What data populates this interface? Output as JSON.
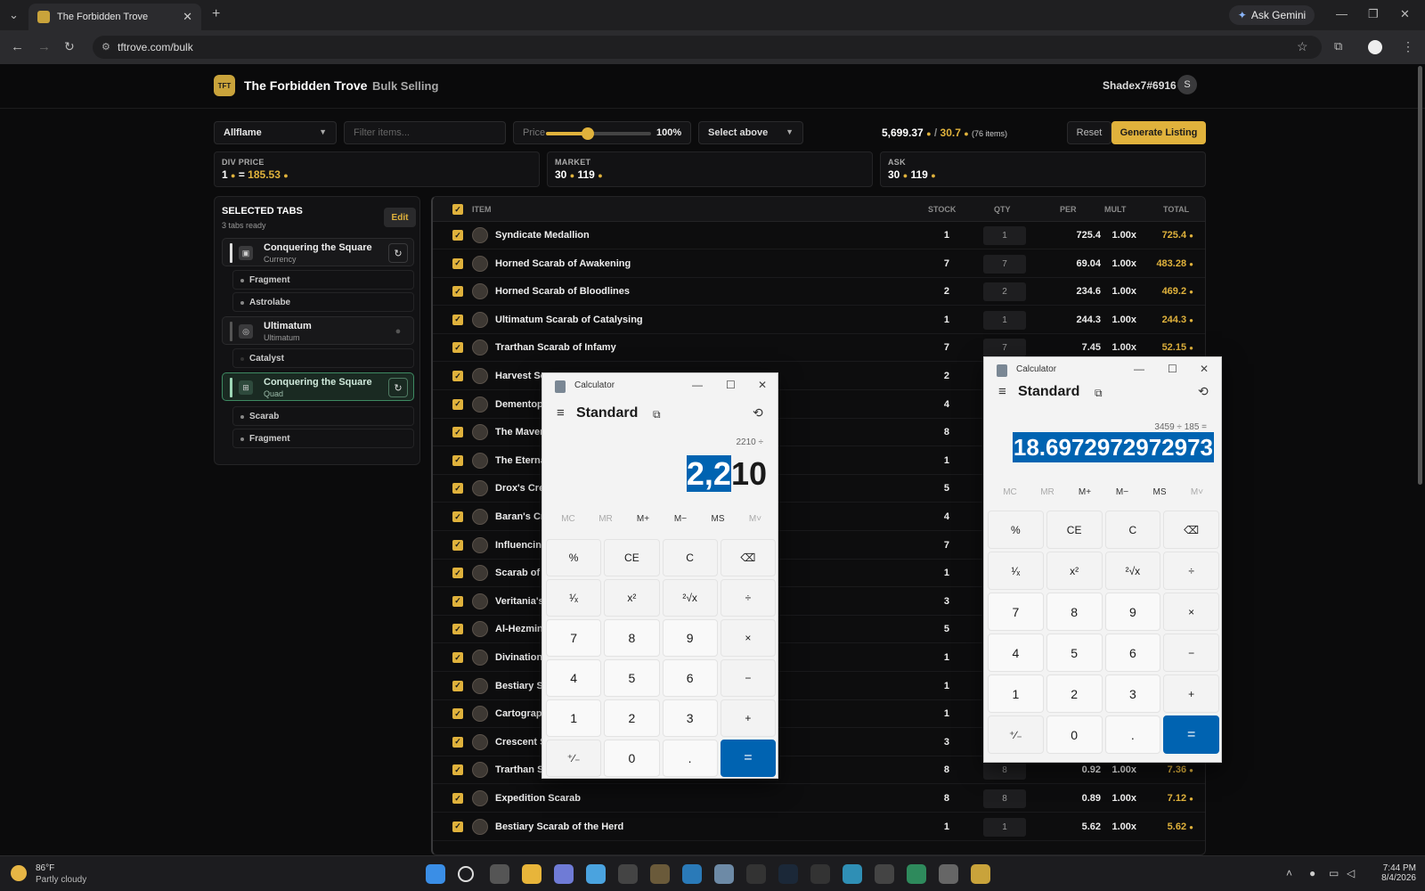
{
  "browser": {
    "tab_title": "The Forbidden Trove",
    "url": "tftrove.com/bulk",
    "ask_gemini": "Ask Gemini"
  },
  "header": {
    "logo_text": "TFT",
    "brand": "The Forbidden Trove",
    "nav_bulk": "Bulk Selling",
    "username": "Shadex7#6916",
    "avatar_letter": "S"
  },
  "controls": {
    "league": "Allflame",
    "filter_placeholder": "Filter items...",
    "price_label": "Price",
    "price_percent": "100%",
    "price_fraction": 0.4,
    "select_above": "Select above",
    "total_chaos": "5,699.37",
    "total_sep": "/",
    "total_div": "30.7",
    "total_items": "(76 items)",
    "reset": "Reset",
    "generate": "Generate Listing"
  },
  "cards": {
    "div_price": {
      "label": "DIV PRICE",
      "prefix": "1",
      "eq": "=",
      "value": "185.53"
    },
    "market": {
      "label": "MARKET",
      "div": "30",
      "chaos": "119"
    },
    "ask": {
      "label": "ASK",
      "div": "30",
      "chaos": "119"
    }
  },
  "sidebar": {
    "title": "SELECTED TABS",
    "subtitle": "3 tabs ready",
    "edit": "Edit",
    "groups": [
      {
        "name": "Conquering the Square",
        "type": "Currency",
        "subtabs": [
          "Fragment",
          "Astrolabe"
        ]
      },
      {
        "name": "Ultimatum",
        "type": "Ultimatum",
        "subtabs": [
          "Catalyst"
        ]
      },
      {
        "name": "Conquering the Square",
        "type": "Quad",
        "subtabs": [
          "Scarab",
          "Fragment"
        ]
      }
    ]
  },
  "table": {
    "headers": {
      "item": "ITEM",
      "stock": "STOCK",
      "qty": "QTY",
      "per": "PER",
      "mult": "MULT",
      "total": "TOTAL"
    },
    "rows": [
      {
        "name": "Syndicate Medallion",
        "stock": "1",
        "qty": "1",
        "per": "725.4",
        "mult": "1.00x",
        "total": "725.4"
      },
      {
        "name": "Horned Scarab of Awakening",
        "stock": "7",
        "qty": "7",
        "per": "69.04",
        "mult": "1.00x",
        "total": "483.28"
      },
      {
        "name": "Horned Scarab of Bloodlines",
        "stock": "2",
        "qty": "2",
        "per": "234.6",
        "mult": "1.00x",
        "total": "469.2"
      },
      {
        "name": "Ultimatum Scarab of Catalysing",
        "stock": "1",
        "qty": "1",
        "per": "244.3",
        "mult": "1.00x",
        "total": "244.3"
      },
      {
        "name": "Trarthan Scarab of Infamy",
        "stock": "7",
        "qty": "7",
        "per": "7.45",
        "mult": "1.00x",
        "total": "52.15"
      },
      {
        "name": "Harvest Sc",
        "stock": "2",
        "qty": "",
        "per": "",
        "mult": "",
        "total": ""
      },
      {
        "name": "Dementop",
        "stock": "4",
        "qty": "",
        "per": "",
        "mult": "",
        "total": ""
      },
      {
        "name": "The Maven",
        "stock": "8",
        "qty": "",
        "per": "",
        "mult": "",
        "total": ""
      },
      {
        "name": "The Eterna",
        "stock": "1",
        "qty": "",
        "per": "",
        "mult": "",
        "total": ""
      },
      {
        "name": "Drox's Cre",
        "stock": "5",
        "qty": "",
        "per": "",
        "mult": "",
        "total": ""
      },
      {
        "name": "Baran's Cr",
        "stock": "4",
        "qty": "",
        "per": "",
        "mult": "",
        "total": ""
      },
      {
        "name": "Influencing",
        "stock": "7",
        "qty": "",
        "per": "",
        "mult": "",
        "total": ""
      },
      {
        "name": "Scarab of",
        "stock": "1",
        "qty": "",
        "per": "",
        "mult": "",
        "total": ""
      },
      {
        "name": "Veritania's",
        "stock": "3",
        "qty": "",
        "per": "",
        "mult": "",
        "total": ""
      },
      {
        "name": "Al-Hezmin",
        "stock": "5",
        "qty": "",
        "per": "",
        "mult": "",
        "total": ""
      },
      {
        "name": "Divination",
        "stock": "1",
        "qty": "",
        "per": "",
        "mult": "",
        "total": ""
      },
      {
        "name": "Bestiary S",
        "stock": "1",
        "qty": "",
        "per": "",
        "mult": "",
        "total": ""
      },
      {
        "name": "Cartograpl",
        "stock": "1",
        "qty": "",
        "per": "",
        "mult": "",
        "total": ""
      },
      {
        "name": "Crescent S",
        "stock": "3",
        "qty": "",
        "per": "",
        "mult": "",
        "total": ""
      },
      {
        "name": "Trarthan Scarab",
        "stock": "8",
        "qty": "8",
        "per": "0.92",
        "mult": "1.00x",
        "total": "7.36"
      },
      {
        "name": "Expedition Scarab",
        "stock": "8",
        "qty": "8",
        "per": "0.89",
        "mult": "1.00x",
        "total": "7.12"
      },
      {
        "name": "Bestiary Scarab of the Herd",
        "stock": "1",
        "qty": "1",
        "per": "5.62",
        "mult": "1.00x",
        "total": "5.62"
      }
    ]
  },
  "calc1": {
    "title": "Calculator",
    "mode": "Standard",
    "expression": "2210 ÷",
    "display_sel": "2,2",
    "display_rest": "10",
    "memory": [
      "MC",
      "MR",
      "M+",
      "M−",
      "MS",
      "M˅"
    ],
    "keys": [
      "%",
      "CE",
      "C",
      "⌫",
      "¹⁄ₓ",
      "x²",
      "²√x",
      "÷",
      "7",
      "8",
      "9",
      "×",
      "4",
      "5",
      "6",
      "−",
      "1",
      "2",
      "3",
      "+",
      "⁺∕₋",
      "0",
      ".",
      "="
    ]
  },
  "calc2": {
    "title": "Calculator",
    "mode": "Standard",
    "expression": "3459 ÷ 185 =",
    "display": "18.6972972972973",
    "memory": [
      "MC",
      "MR",
      "M+",
      "M−",
      "MS",
      "M˅"
    ],
    "keys": [
      "%",
      "CE",
      "C",
      "⌫",
      "¹⁄ₓ",
      "x²",
      "²√x",
      "÷",
      "7",
      "8",
      "9",
      "×",
      "4",
      "5",
      "6",
      "−",
      "1",
      "2",
      "3",
      "+",
      "⁺∕₋",
      "0",
      ".",
      "="
    ]
  },
  "taskbar": {
    "temp": "86°F",
    "weather": "Partly cloudy",
    "time": "7:44 PM",
    "date": "8/4/2026"
  },
  "colors": {
    "accent": "#e0b23c",
    "calc_blue": "#0063b1",
    "active_tab": "#3e8a62"
  }
}
